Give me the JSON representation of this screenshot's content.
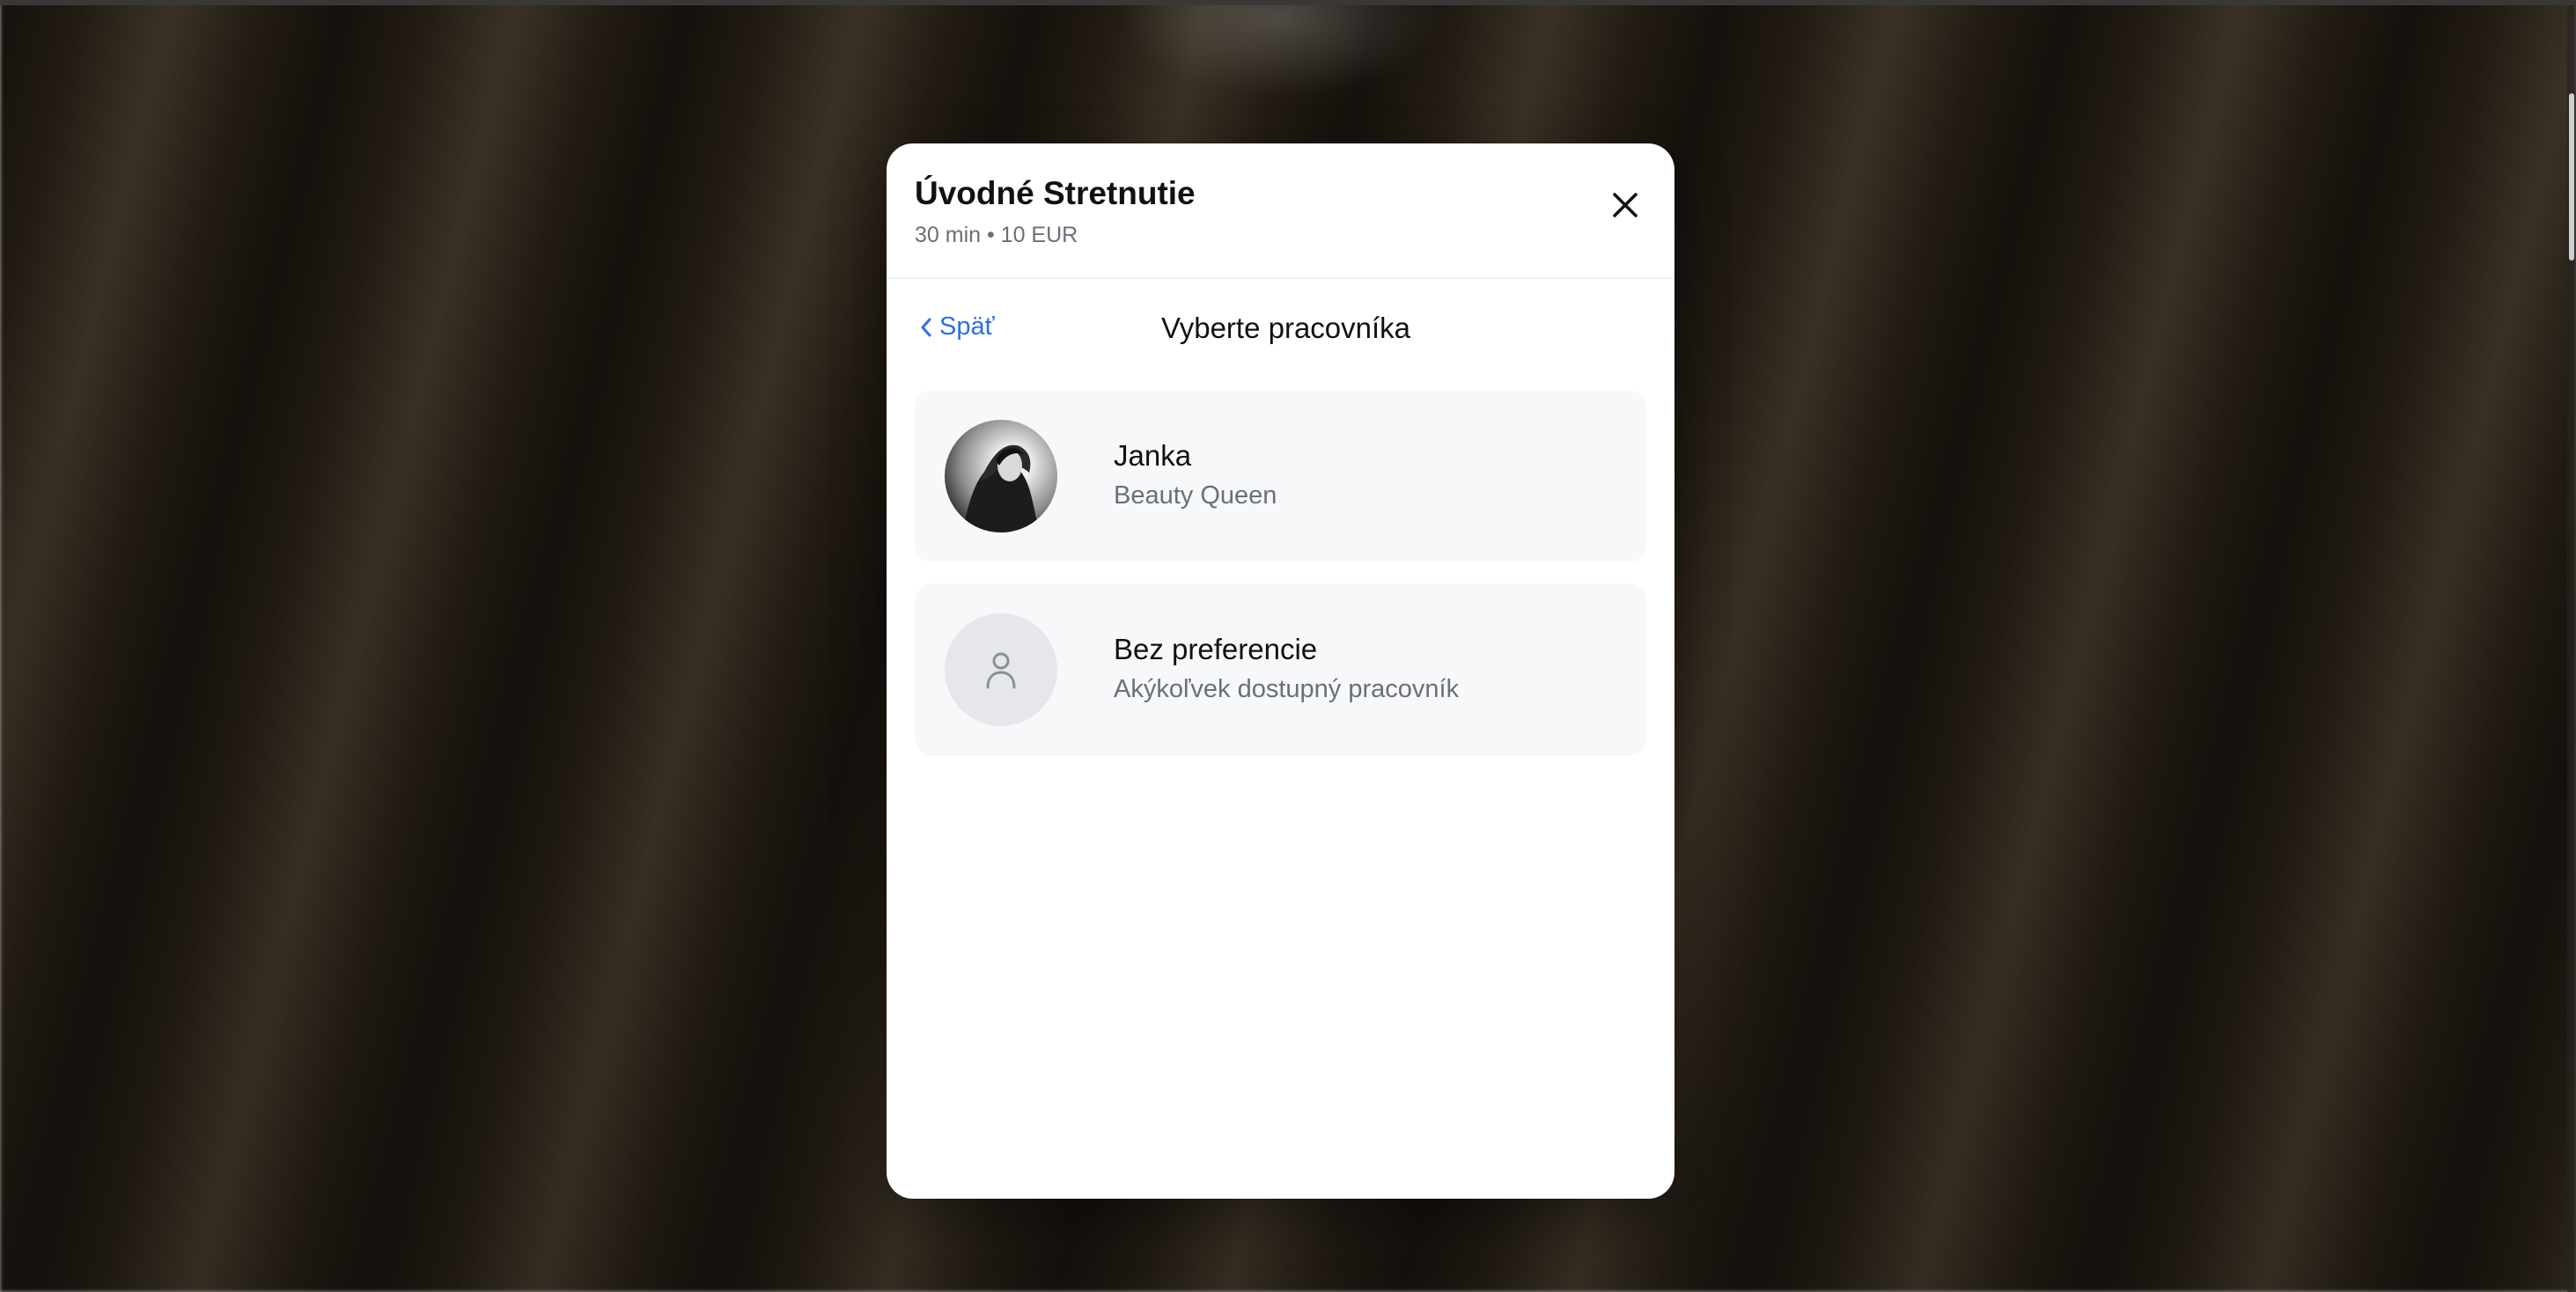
{
  "modal": {
    "title": "Úvodné Stretnutie",
    "subtitle": "30 min • 10 EUR",
    "close_icon": "close-icon"
  },
  "nav": {
    "back_label": "Späť",
    "back_icon": "chevron-left-icon",
    "title": "Vyberte pracovníka"
  },
  "staff": [
    {
      "name": "Janka",
      "role": "Beauty Queen",
      "avatar": "avatar-photo"
    },
    {
      "name": "Bez preferencie",
      "role": "Akýkoľvek dostupný pracovník",
      "avatar": "user-icon"
    }
  ],
  "colors": {
    "accent": "#2f6fe0",
    "card_bg": "#f7f8fa",
    "muted_text": "#6b6f76"
  }
}
